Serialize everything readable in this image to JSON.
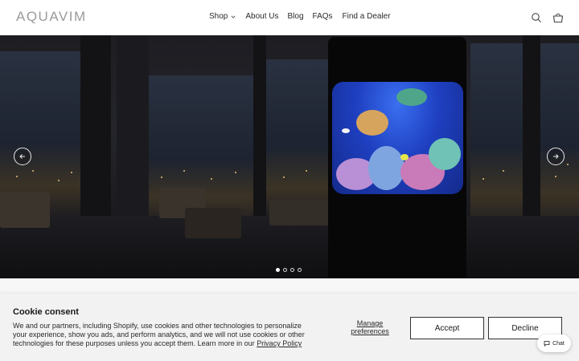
{
  "header": {
    "logo": "AQUAVIM",
    "nav": [
      {
        "label": "Shop",
        "has_dropdown": true
      },
      {
        "label": "About Us"
      },
      {
        "label": "Blog"
      },
      {
        "label": "FAQs"
      },
      {
        "label": "Find a Dealer"
      }
    ],
    "icons": [
      "search-icon",
      "cart-icon"
    ]
  },
  "hero": {
    "slides_total": 4,
    "active_slide": 1,
    "icons": [
      "arrow-left-icon",
      "arrow-right-icon"
    ]
  },
  "cookie": {
    "title": "Cookie consent",
    "text": "We and our partners, including Shopify, use cookies and other technologies to personalize your experience, show you ads, and perform analytics, and we will not use cookies or other technologies for these purposes unless you accept them. Learn more in our ",
    "privacy_link": "Privacy Policy",
    "manage_label": "Manage preferences",
    "accept_label": "Accept",
    "decline_label": "Decline"
  },
  "chat": {
    "label": "Chat",
    "icon": "chat-bubble-icon"
  },
  "colors": {
    "logo": "#9a9a9a",
    "banner_bg": "#f2f2f2",
    "tank_blue": "#1e3fc0"
  }
}
